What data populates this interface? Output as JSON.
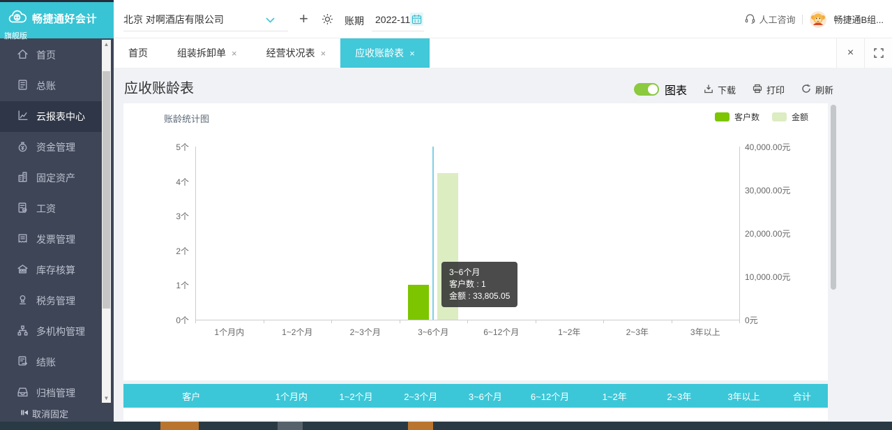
{
  "brand": {
    "name": "畅捷通好会计",
    "edition": "旗舰版"
  },
  "topbar": {
    "company": "北京 对啊酒店有限公司",
    "plus": "+",
    "period_label": "账期",
    "period_value": "2022-11",
    "support": "人工咨询",
    "user": "畅捷通B组..."
  },
  "sidebar": {
    "items": [
      {
        "label": "首页",
        "icon": "home-icon",
        "active": false
      },
      {
        "label": "总账",
        "icon": "ledger-icon",
        "active": false
      },
      {
        "label": "云报表中心",
        "icon": "report-center-icon",
        "active": true
      },
      {
        "label": "资金管理",
        "icon": "funds-icon",
        "active": false
      },
      {
        "label": "固定资产",
        "icon": "fixed-assets-icon",
        "active": false
      },
      {
        "label": "工资",
        "icon": "payroll-icon",
        "active": false
      },
      {
        "label": "发票管理",
        "icon": "invoice-icon",
        "active": false
      },
      {
        "label": "库存核算",
        "icon": "inventory-icon",
        "active": false
      },
      {
        "label": "税务管理",
        "icon": "tax-icon",
        "active": false
      },
      {
        "label": "多机构管理",
        "icon": "multi-org-icon",
        "active": false
      },
      {
        "label": "结账",
        "icon": "closing-icon",
        "active": false
      },
      {
        "label": "归档管理",
        "icon": "archive-icon",
        "active": false
      }
    ],
    "unpin_label": "取消固定"
  },
  "tabs": [
    {
      "label": "首页",
      "closable": false,
      "active": false
    },
    {
      "label": "组装拆卸单",
      "closable": true,
      "active": false
    },
    {
      "label": "经营状况表",
      "closable": true,
      "active": false
    },
    {
      "label": "应收账龄表",
      "closable": true,
      "active": true
    }
  ],
  "tab_close_all": "×",
  "page": {
    "title": "应收账龄表",
    "toolbar": {
      "chart_toggle": "图表",
      "download": "下载",
      "print": "打印",
      "refresh": "刷新"
    }
  },
  "chart_data": {
    "type": "bar",
    "title": "账龄统计图",
    "categories": [
      "1个月内",
      "1~2个月",
      "2~3个月",
      "3~6个月",
      "6~12个月",
      "1~2年",
      "2~3年",
      "3年以上"
    ],
    "series": [
      {
        "name": "客户数",
        "color": "#7cc500",
        "axis": "left",
        "values": [
          0,
          0,
          0,
          1,
          0,
          0,
          0,
          0
        ]
      },
      {
        "name": "金额",
        "color": "#dcedc2",
        "axis": "right",
        "values": [
          0,
          0,
          0,
          33805.05,
          0,
          0,
          0,
          0
        ]
      }
    ],
    "left_axis": {
      "ticks": [
        "0个",
        "1个",
        "2个",
        "3个",
        "4个",
        "5个"
      ],
      "max": 5
    },
    "right_axis": {
      "ticks": [
        "0元",
        "10,000.00元",
        "20,000.00元",
        "30,000.00元",
        "40,000.00元"
      ],
      "max": 40000
    },
    "highlight_index": 3,
    "tooltip": {
      "title": "3~6个月",
      "rows": [
        {
          "label": "客户数",
          "value": "1"
        },
        {
          "label": "金额",
          "value": "33,805.05"
        }
      ]
    },
    "legend_position": "top-right",
    "grid": false
  },
  "table": {
    "headers": [
      "客户",
      "1个月内",
      "1~2个月",
      "2~3个月",
      "3~6个月",
      "6~12个月",
      "1~2年",
      "2~3年",
      "3年以上",
      "合计"
    ]
  },
  "colors": {
    "accent_cyan": "#3cc6d6",
    "sidebar_bg": "#3e4557",
    "toggle_green": "#8bc93f",
    "bar_green": "#7cc500",
    "bar_pale_green": "#dcedc2",
    "tooltip_bg": "rgba(50,50,50,0.88)",
    "taskbar_orange": "#b9752f",
    "taskbar_gray": "#57636c"
  }
}
